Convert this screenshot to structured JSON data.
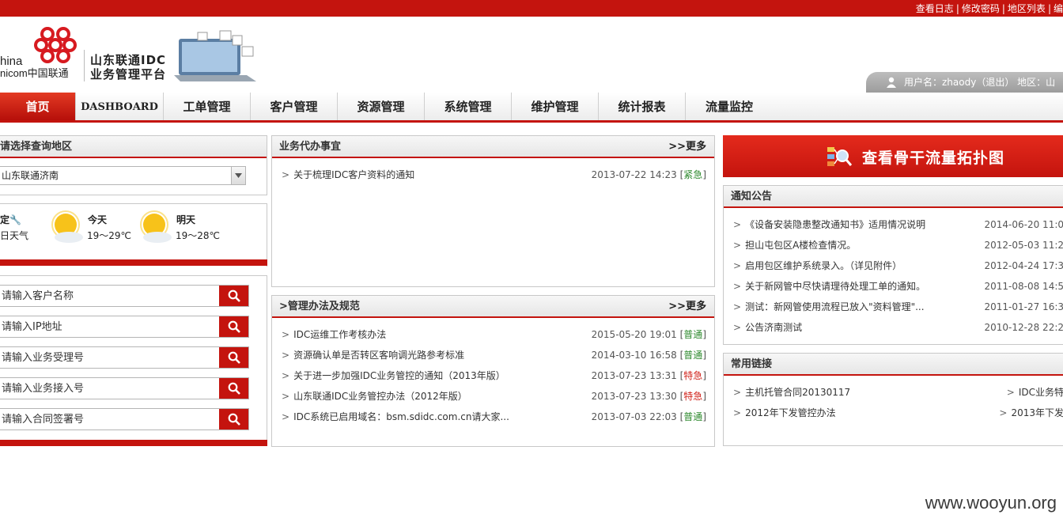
{
  "top_links": [
    "查看日志",
    "修改密码",
    "地区列表",
    "编"
  ],
  "logo": {
    "china_line1": "hina",
    "china_line2": "nicom中国联通",
    "title_line1": "山东联通IDC",
    "title_line2": "业务管理平台"
  },
  "user_bar": {
    "text": "用户名：zhaody（退出）  地区：山"
  },
  "nav": [
    "首页",
    "DASHBOARD",
    "工单管理",
    "客户管理",
    "资源管理",
    "系统管理",
    "维护管理",
    "统计报表",
    "流量监控"
  ],
  "region_panel": {
    "title": "请选择查询地区",
    "selected": "山东联通济南"
  },
  "weather": {
    "label1": "定",
    "label2": "日天气",
    "today_label": "今天",
    "today_range": "19～29℃",
    "tomorrow_label": "明天",
    "tomorrow_range": "19～28℃"
  },
  "search_fields": [
    "请输入客户名称",
    "请输入IP地址",
    "请输入业务受理号",
    "请输入业务接入号",
    "请输入合同签署号"
  ],
  "todo": {
    "title": "业务代办事宜",
    "more": ">>更多",
    "items": [
      {
        "text": "关于梳理IDC客户资料的通知",
        "date": "2013-07-22 14:23",
        "tag": "紧急"
      }
    ]
  },
  "rules": {
    "title": ">管理办法及规范",
    "more": ">>更多",
    "items": [
      {
        "text": "IDC运维工作考核办法",
        "date": "2015-05-20 19:01",
        "tag": "普通"
      },
      {
        "text": "资源确认单是否转区客响调光路参考标准",
        "date": "2014-03-10 16:58",
        "tag": "普通"
      },
      {
        "text": "关于进一步加强IDC业务管控的通知（2013年版）",
        "date": "2013-07-23 13:31",
        "tag": "特急"
      },
      {
        "text": "山东联通IDC业务管控办法（2012年版）",
        "date": "2013-07-23 13:30",
        "tag": "特急"
      },
      {
        "text": "IDC系统已启用域名：bsm.sdidc.com.cn请大家...",
        "date": "2013-07-03 22:03",
        "tag": "普通"
      }
    ]
  },
  "topology_button": "查看骨干流量拓扑图",
  "notices": {
    "title": "通知公告",
    "items": [
      {
        "text": "《设备安装隐患整改通知书》适用情况说明",
        "date": "2014-06-20 11:0"
      },
      {
        "text": "担山屯包区A楼检查情况。",
        "date": "2012-05-03 11:2"
      },
      {
        "text": "启用包区维护系统录入。（详见附件）",
        "date": "2012-04-24 17:3"
      },
      {
        "text": "关于新网管中尽快请理待处理工单的通知。",
        "date": "2011-08-08 14:5"
      },
      {
        "text": "测试：新网管使用流程已放入\"资料管理\"...",
        "date": "2011-01-27 16:3"
      },
      {
        "text": "公告济南测试",
        "date": "2010-12-28 22:2"
      }
    ]
  },
  "links": {
    "title": "常用链接",
    "left": [
      "主机托管合同20130117",
      "2012年下发管控办法"
    ],
    "right": [
      "IDC业务特",
      "2013年下发"
    ]
  },
  "watermark": "www.wooyun.org",
  "colors": {
    "brand_red": "#c4140e",
    "normal_tag": "#2f8a2f",
    "urgent_tag": "#d0231b"
  }
}
